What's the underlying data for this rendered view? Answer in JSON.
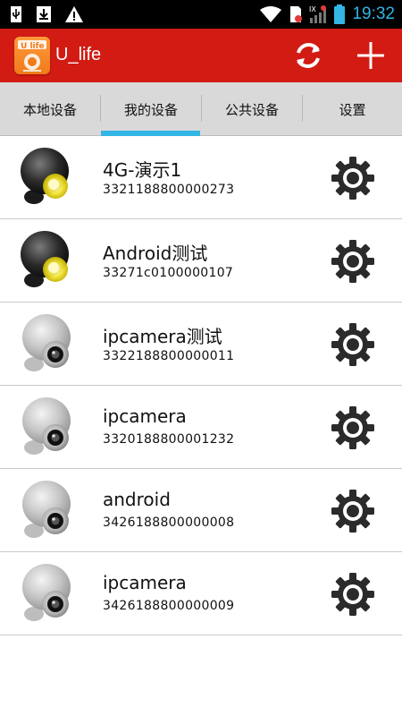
{
  "status_bar": {
    "time": "19:32",
    "icons": [
      "usb-icon",
      "download-icon",
      "warning-icon",
      "wifi-icon",
      "sim-icon",
      "signal-icon",
      "battery-icon"
    ]
  },
  "app": {
    "title": "U_life",
    "logo_text": "U life",
    "accent_color": "#d21b13",
    "tab_indicator_color": "#33b5e5"
  },
  "tabs": [
    {
      "label": "本地设备",
      "selected": false
    },
    {
      "label": "我的设备",
      "selected": true
    },
    {
      "label": "公共设备",
      "selected": false
    },
    {
      "label": "设置",
      "selected": false
    }
  ],
  "devices": [
    {
      "name": "4G-演示1",
      "id": "3321188800000273",
      "online": true
    },
    {
      "name": "Android测试",
      "id": "33271c0100000107",
      "online": true
    },
    {
      "name": "ipcamera测试",
      "id": "3322188800000011",
      "online": false
    },
    {
      "name": "ipcamera",
      "id": "3320188800001232",
      "online": false
    },
    {
      "name": "android",
      "id": "3426188800000008",
      "online": false
    },
    {
      "name": "ipcamera",
      "id": "3426188800000009",
      "online": false
    }
  ]
}
